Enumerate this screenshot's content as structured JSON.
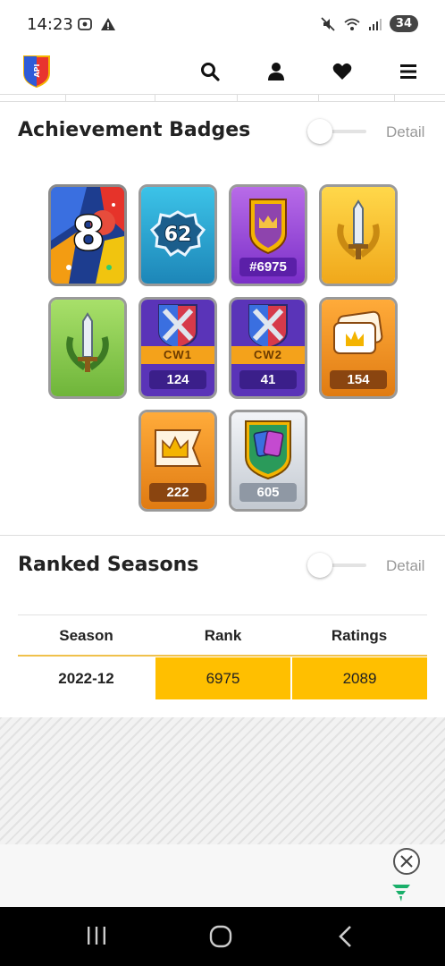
{
  "status": {
    "time": "14:23",
    "battery": "34"
  },
  "header": {
    "logo_text": "API"
  },
  "achievements": {
    "title": "Achievement Badges",
    "toggle_label": "Detail",
    "badges": [
      {
        "icon": "years-played-badge-icon",
        "big": "8"
      },
      {
        "icon": "level-badge-icon",
        "big": "62"
      },
      {
        "icon": "ranked-crown-shield-icon",
        "count": "#6975"
      },
      {
        "icon": "gold-sword-laurel-icon"
      },
      {
        "icon": "green-sword-laurel-icon"
      },
      {
        "icon": "clan-war-1-icon",
        "tag": "CW1",
        "count": "124"
      },
      {
        "icon": "clan-war-2-icon",
        "tag": "CW2",
        "count": "41"
      },
      {
        "icon": "crown-cards-icon",
        "count": "154"
      },
      {
        "icon": "crown-flag-icon",
        "count": "222"
      },
      {
        "icon": "card-collection-icon",
        "count": "605"
      }
    ]
  },
  "ranked": {
    "title": "Ranked Seasons",
    "toggle_label": "Detail",
    "columns": [
      "Season",
      "Rank",
      "Ratings"
    ],
    "rows": [
      {
        "season": "2022-12",
        "rank": "6975",
        "rating": "2089"
      }
    ]
  },
  "colors": {
    "highlight": "#ffbf00",
    "accent_line": "#f0c14b"
  }
}
